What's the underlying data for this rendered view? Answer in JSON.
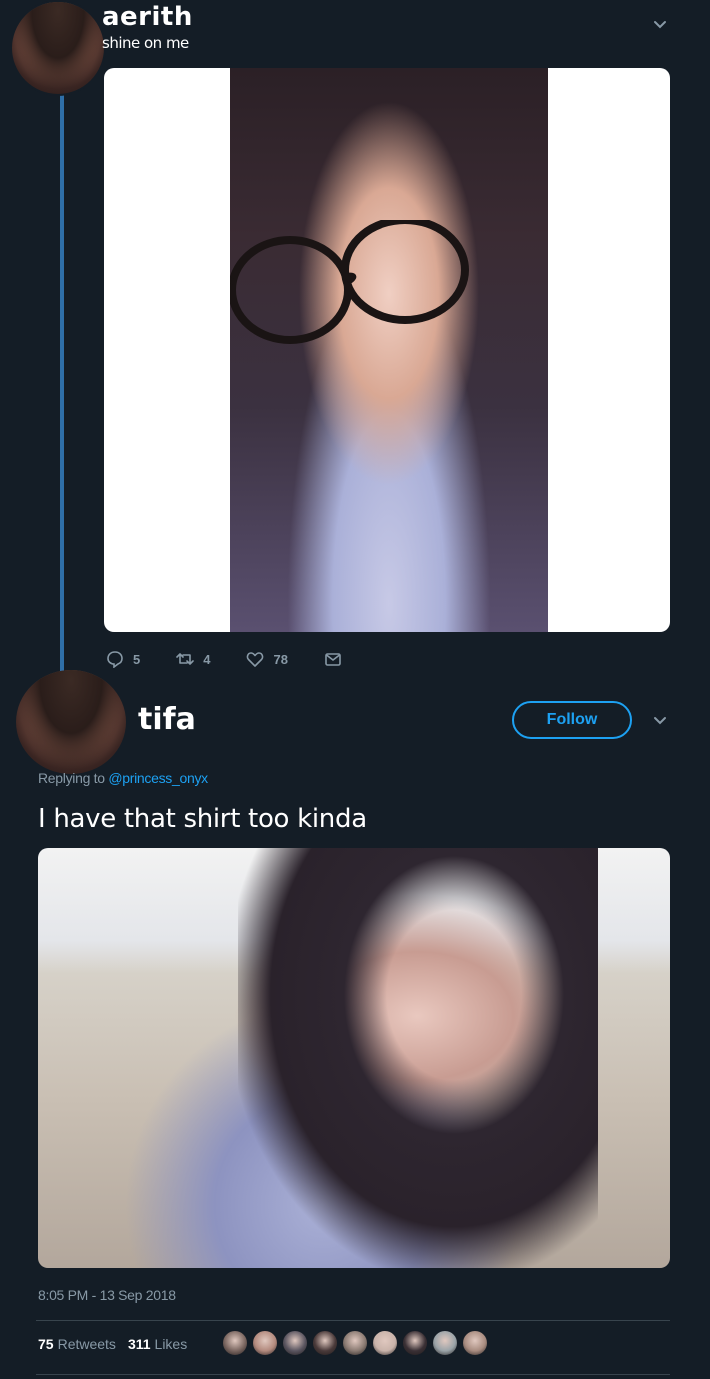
{
  "original_tweet": {
    "display_name": "aerith",
    "bio_line": "shine on me",
    "actions": {
      "replies": "5",
      "retweets": "4",
      "likes": "78"
    }
  },
  "reply_tweet": {
    "display_name": "tifa",
    "follow_label": "Follow",
    "replying_prefix": "Replying to",
    "replying_handle": "@princess_onyx",
    "text": "I have that shirt too kinda",
    "timestamp": "8:05 PM - 13 Sep 2018",
    "stats": {
      "retweets_count": "75",
      "retweets_label": "Retweets",
      "likes_count": "311",
      "likes_label": "Likes"
    }
  },
  "colors": {
    "background": "#141d26",
    "accent": "#1da1f2",
    "muted": "#8899a6",
    "thread_line": "#2f6fa8"
  },
  "icons": [
    "chevron-down-icon",
    "reply-icon",
    "retweet-icon",
    "like-icon",
    "dm-icon"
  ],
  "liker_colors": [
    "#7a6660",
    "#b38a7e",
    "#5a5560",
    "#4a3a3a",
    "#8a7a72",
    "#c9b3aa",
    "#3a3035",
    "#9aa3a8",
    "#a88c80"
  ]
}
